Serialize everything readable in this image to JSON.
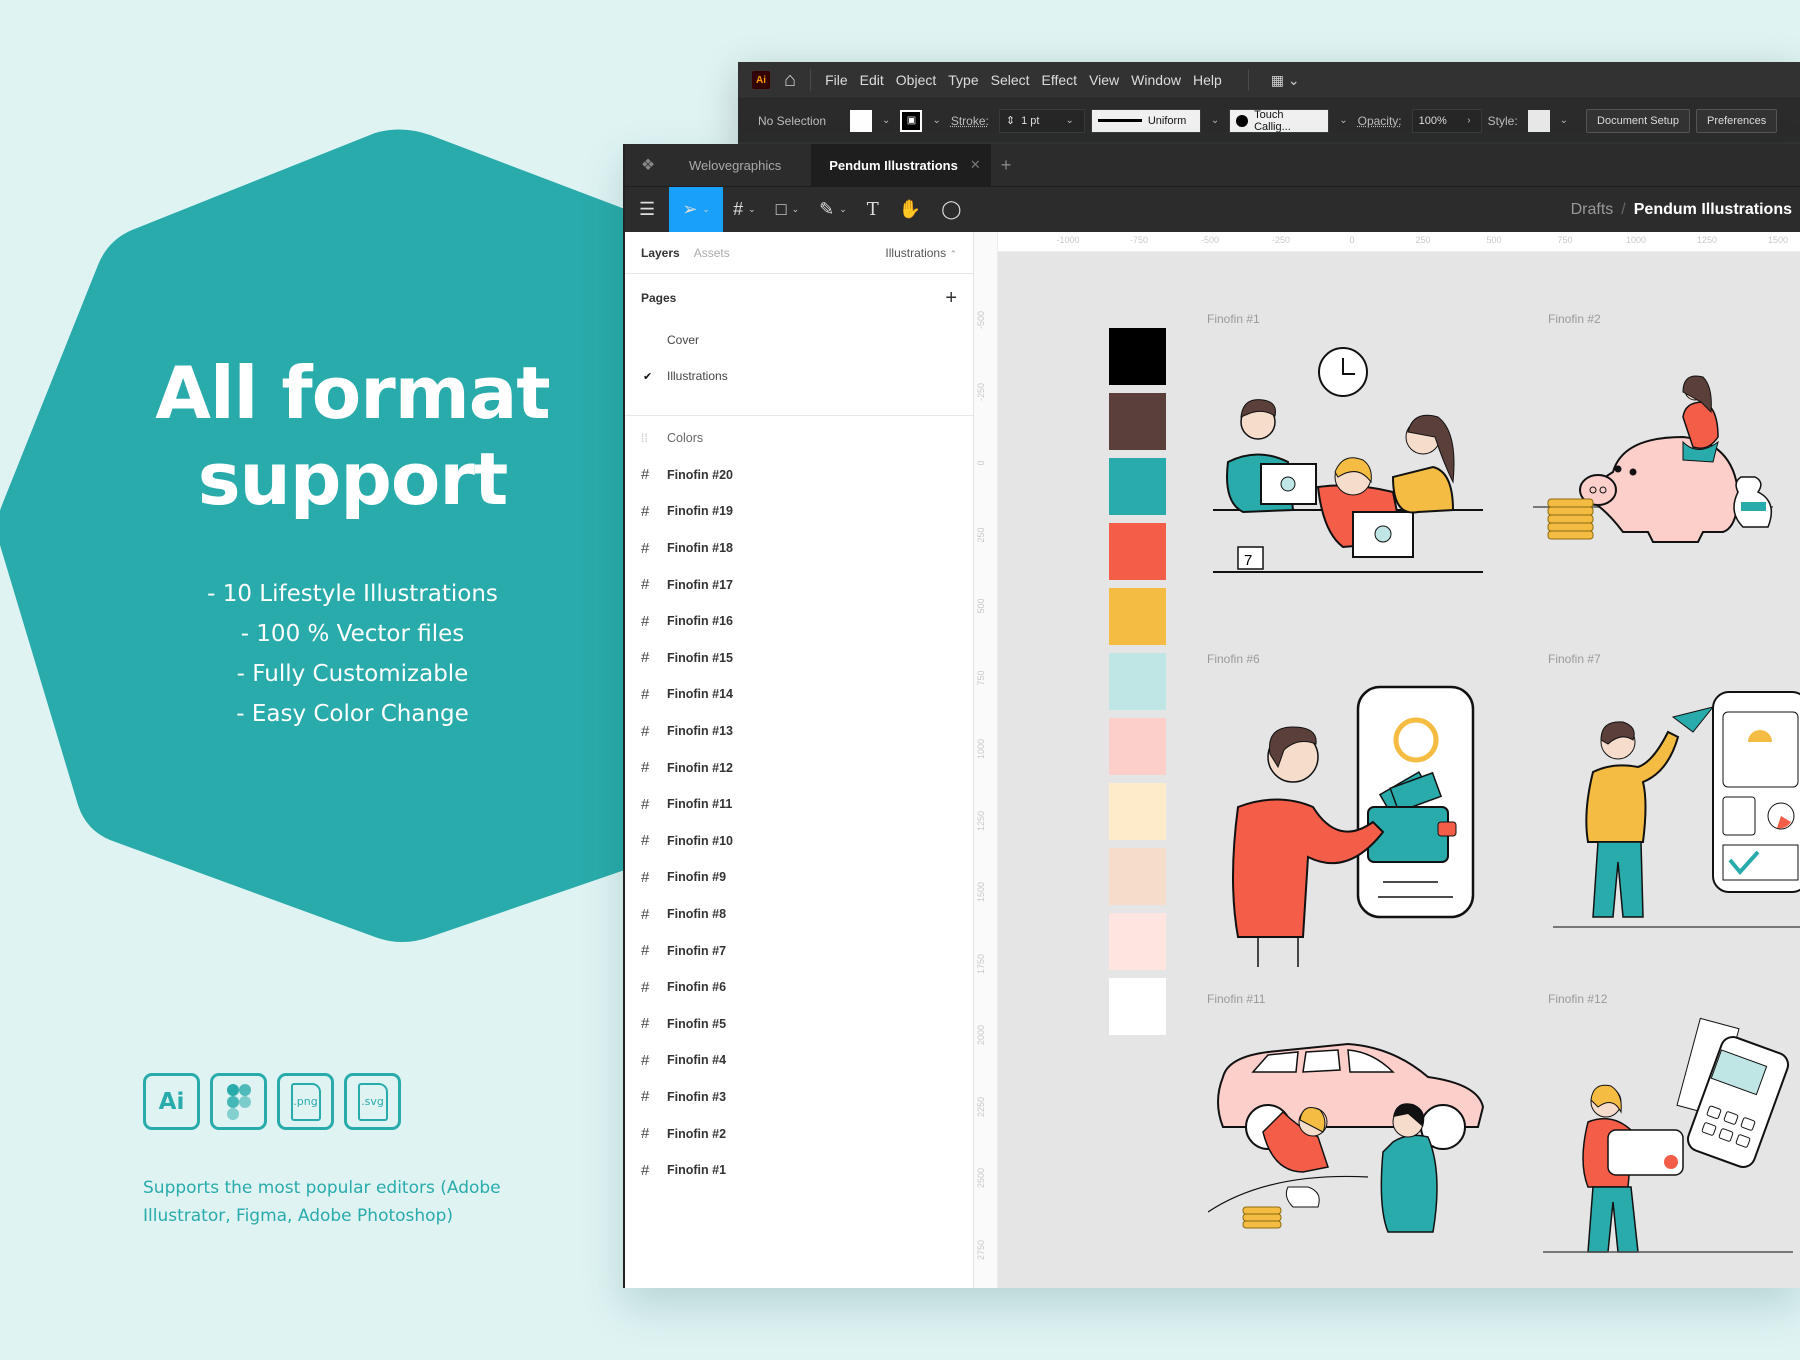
{
  "promo": {
    "title_line1": "All format",
    "title_line2": "support",
    "features": [
      "- 10 Lifestyle Illustrations",
      "- 100 % Vector files",
      "- Fully Customizable",
      "- Easy Color Change"
    ],
    "formats": [
      {
        "icon": "adobe-illustrator-icon",
        "label": "Ai"
      },
      {
        "icon": "figma-icon",
        "label": ""
      },
      {
        "icon": "png-file-icon",
        "label": ".png"
      },
      {
        "icon": "svg-file-icon",
        "label": ".svg"
      }
    ],
    "support_text": "Supports the most popular editors (Adobe Illustrator, Figma, Adobe Photoshop)",
    "accent": "#2aabab",
    "background": "#dff3f3"
  },
  "illustrator": {
    "logo": "Ai",
    "menu": [
      "File",
      "Edit",
      "Object",
      "Type",
      "Select",
      "Effect",
      "View",
      "Window",
      "Help"
    ],
    "control_bar": {
      "selection": "No Selection",
      "stroke_label": "Stroke:",
      "stroke_value": "1 pt",
      "profile": "Uniform",
      "brush": "Touch Callig...",
      "opacity_label": "Opacity:",
      "opacity_value": "100%",
      "style_label": "Style:",
      "document_setup": "Document Setup",
      "preferences": "Preferences"
    }
  },
  "figma": {
    "tabs": [
      {
        "label": "Welovegraphics",
        "active": false
      },
      {
        "label": "Pendum Illustrations",
        "active": true
      }
    ],
    "breadcrumb": {
      "parent": "Drafts",
      "current": "Pendum Illustrations"
    },
    "layers_panel": {
      "tab_layers": "Layers",
      "tab_assets": "Assets",
      "page_selector": "Illustrations",
      "pages_header": "Pages",
      "pages": [
        {
          "label": "Cover",
          "selected": false
        },
        {
          "label": "Illustrations",
          "selected": true
        }
      ],
      "layers": [
        "Colors",
        "Finofin #20",
        "Finofin #19",
        "Finofin #18",
        "Finofin #17",
        "Finofin #16",
        "Finofin #15",
        "Finofin #14",
        "Finofin #13",
        "Finofin #12",
        "Finofin #11",
        "Finofin #10",
        "Finofin #9",
        "Finofin #8",
        "Finofin #7",
        "Finofin #6",
        "Finofin #5",
        "Finofin #4",
        "Finofin #3",
        "Finofin #2",
        "Finofin #1"
      ]
    },
    "ruler_h": [
      "-1000",
      "-750",
      "-500",
      "-250",
      "0",
      "250",
      "500",
      "750",
      "1000",
      "1250",
      "1500"
    ],
    "ruler_v": [
      "-500",
      "-250",
      "0",
      "250",
      "500",
      "750",
      "1000",
      "1250",
      "1500",
      "1750",
      "2000",
      "2250",
      "2500",
      "2750"
    ],
    "palette": [
      "#000000",
      "#5b3f3a",
      "#2aabab",
      "#f45d48",
      "#f4bc42",
      "#bfe5e5",
      "#fccfcb",
      "#fdebc9",
      "#f6dccb",
      "#fee5df",
      "#ffffff"
    ],
    "frames": [
      "Finofin #1",
      "Finofin #2",
      "Finofin #6",
      "Finofin #7",
      "Finofin #11",
      "Finofin #12"
    ],
    "accent": "#18a0fb"
  }
}
